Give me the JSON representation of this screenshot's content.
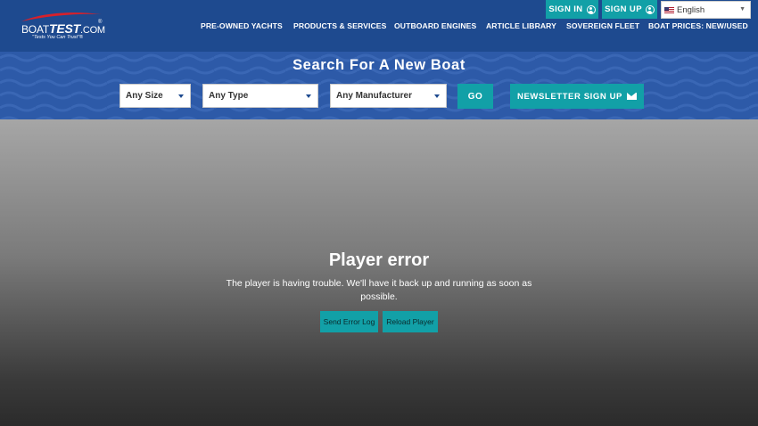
{
  "header": {
    "logo": {
      "boat": "BOAT",
      "test": "TEST",
      "com": ".COM",
      "reg": "®",
      "tagline": "\"Tests You Can Trust\"®"
    },
    "sign_in": "SIGN IN",
    "sign_up": "SIGN UP",
    "language": "English",
    "nav": [
      "PRE-OWNED YACHTS",
      "PRODUCTS & SERVICES",
      "OUTBOARD ENGINES",
      "ARTICLE LIBRARY",
      "SOVEREIGN FLEET",
      "BOAT PRICES: NEW/USED"
    ]
  },
  "search": {
    "title": "Search For A New Boat",
    "size": "Any Size",
    "type": "Any Type",
    "manufacturer": "Any Manufacturer",
    "go": "GO",
    "newsletter": "NEWSLETTER SIGN UP"
  },
  "player": {
    "title": "Player error",
    "message": "The player is having trouble. We'll have it back up and running as soon as possible.",
    "send_log": "Send Error Log",
    "reload": "Reload Player"
  },
  "colors": {
    "header_bg": "#1e4a8f",
    "search_bg": "#2d5aa8",
    "accent_teal": "#12a0a7",
    "logo_red": "#d8202a"
  },
  "icons": {
    "user": "user-circle-icon",
    "flag": "us-flag-icon",
    "dropdown": "caret-down-icon",
    "mail": "envelope-icon"
  }
}
